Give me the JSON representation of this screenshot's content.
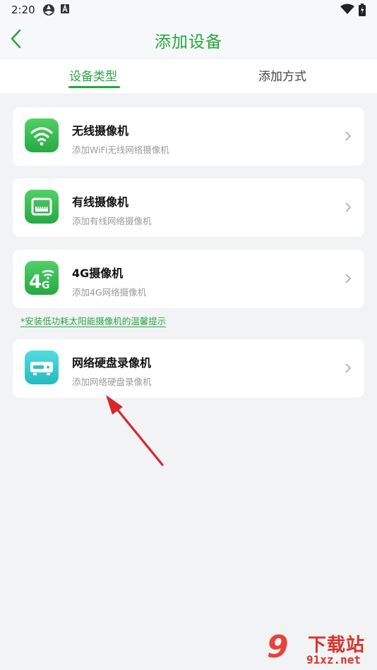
{
  "status_bar": {
    "time": "2:20",
    "icons": [
      "vpn-icon",
      "a-icon",
      "wifi-icon",
      "battery-icon"
    ]
  },
  "header": {
    "title": "添加设备",
    "back_icon": "chevron-left-icon"
  },
  "tabs": [
    {
      "label": "设备类型",
      "active": true
    },
    {
      "label": "添加方式",
      "active": false
    }
  ],
  "devices": [
    {
      "title": "无线摄像机",
      "subtitle": "添加WiFi无线网络摄像机",
      "icon": "wifi-camera-icon"
    },
    {
      "title": "有线摄像机",
      "subtitle": "添加有线网络摄像机",
      "icon": "wired-camera-icon"
    },
    {
      "title": "4G摄像机",
      "subtitle": "添加4G网络摄像机",
      "icon": "4g-camera-icon"
    },
    {
      "title": "网络硬盘录像机",
      "subtitle": "添加网络硬盘录像机",
      "icon": "nvr-icon"
    }
  ],
  "tip_link": "*安装低功耗太阳能摄像机的温馨提示",
  "watermark": {
    "logo": "9",
    "title": "下载站",
    "url": "91xz.net"
  },
  "colors": {
    "accent": "#26a541",
    "background": "#f2f3f5",
    "annotation_arrow": "#d62828"
  }
}
